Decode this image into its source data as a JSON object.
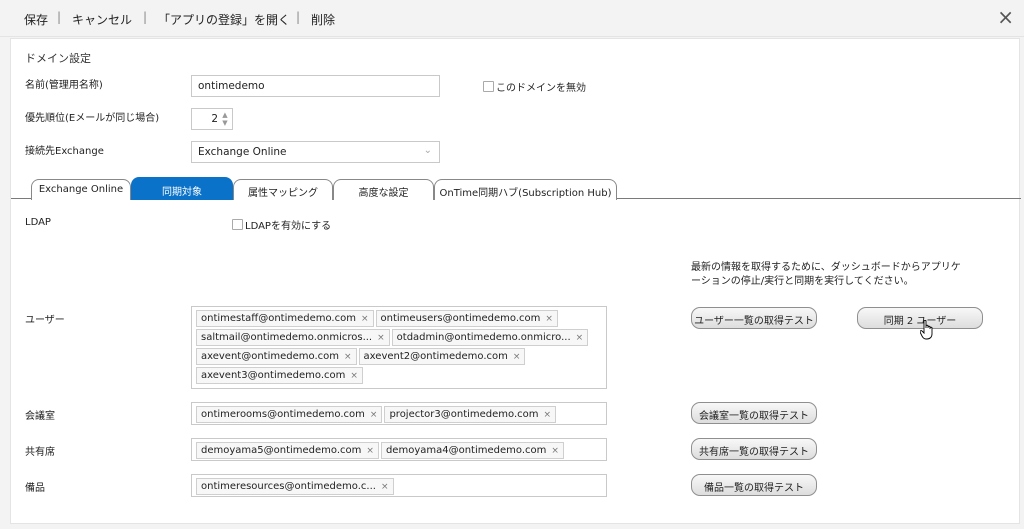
{
  "toolbar": {
    "save": "保存",
    "cancel": "キャンセル",
    "open_app": "「アプリの登録」を開く",
    "delete": "削除",
    "separator": "|",
    "close_icon": "×"
  },
  "domain": {
    "section_title": "ドメイン設定",
    "name_label": "名前(管理用名称)",
    "name_value": "ontimedemo",
    "disable_label": "このドメインを無効",
    "priority_label": "優先順位(Eメールが同じ場合)",
    "priority_value": "2",
    "exchange_label": "接続先Exchange",
    "exchange_value": "Exchange Online"
  },
  "tabs": [
    {
      "label": "Exchange Online",
      "active": false
    },
    {
      "label": "同期対象",
      "active": true
    },
    {
      "label": "属性マッピング",
      "active": false
    },
    {
      "label": "高度な設定",
      "active": false
    },
    {
      "label": "OnTime同期ハブ(Subscription Hub)",
      "active": false
    }
  ],
  "ldap": {
    "label": "LDAP",
    "enable_label": "LDAPを有効にする"
  },
  "note": "最新の情報を取得するために、ダッシュボードからアプリケーションの停止/実行と同期を実行してください。",
  "users": {
    "label": "ユーザー",
    "tags": [
      "ontimestaff@ontimedemo.com",
      "ontimeusers@ontimedemo.com",
      "saltmail@ontimedemo.onmicros...",
      "otdadmin@ontimedemo.onmicro...",
      "axevent@ontimedemo.com",
      "axevent2@ontimedemo.com",
      "axevent3@ontimedemo.com"
    ],
    "test_button": "ユーザー一覧の取得テスト",
    "sync_button": "同期 2 ユーザー"
  },
  "rooms": {
    "label": "会議室",
    "tags": [
      "ontimerooms@ontimedemo.com",
      "projector3@ontimedemo.com"
    ],
    "test_button": "会議室一覧の取得テスト"
  },
  "desks": {
    "label": "共有席",
    "tags": [
      "demoyama5@ontimedemo.com",
      "demoyama4@ontimedemo.com"
    ],
    "test_button": "共有席一覧の取得テスト"
  },
  "equipment": {
    "label": "備品",
    "tags": [
      "ontimeresources@ontimedemo.c..."
    ],
    "test_button": "備品一覧の取得テスト"
  },
  "icons": {
    "close": "close-icon",
    "tag_remove": "x-icon",
    "spinner": "spinner-arrows-icon",
    "chevron": "chevron-down-icon",
    "cursor": "hand-pointer-icon"
  },
  "tag_remove_glyph": "×"
}
